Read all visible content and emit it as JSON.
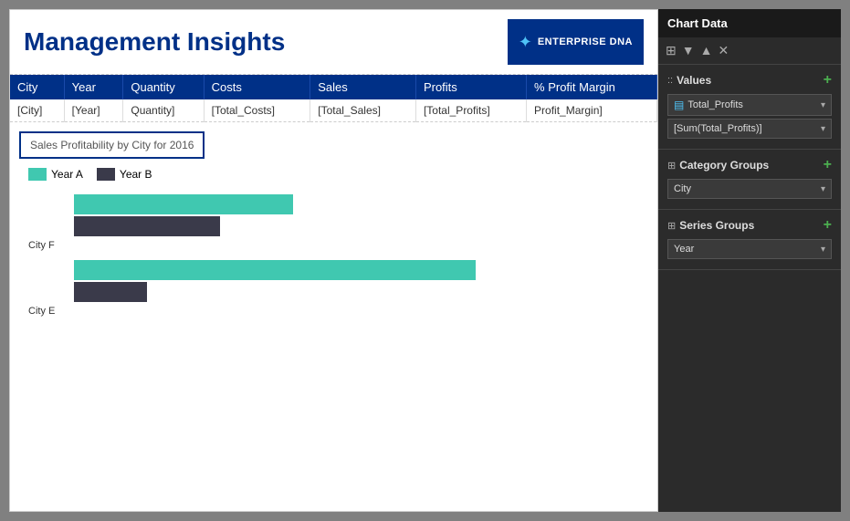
{
  "header": {
    "title": "Management Insights",
    "logo_text": "ENTERPRISE DNA"
  },
  "table": {
    "columns": [
      {
        "key": "city",
        "label": "City"
      },
      {
        "key": "year",
        "label": "Year"
      },
      {
        "key": "quantity",
        "label": "Quantity"
      },
      {
        "key": "costs",
        "label": "Costs"
      },
      {
        "key": "sales",
        "label": "Sales"
      },
      {
        "key": "profits",
        "label": "Profits"
      },
      {
        "key": "margin",
        "label": "% Profit Margin"
      }
    ],
    "row": {
      "city": "[City]",
      "year": "[Year]",
      "quantity": "Quantity]",
      "costs": "[Total_Costs]",
      "sales": "[Total_Sales]",
      "profits": "[Total_Profits]",
      "margin": "Profit_Margin]"
    }
  },
  "chart": {
    "title": "Sales Profitability by City for 2016",
    "legend": {
      "year_a_label": "Year A",
      "year_b_label": "Year B"
    },
    "cities": [
      {
        "name": "City F",
        "year_a_width": 240,
        "year_b_width": 160
      },
      {
        "name": "City E",
        "year_a_width": 440,
        "year_b_width": 80
      }
    ]
  },
  "right_panel": {
    "title": "Chart Data",
    "toolbar_icons": [
      "grid",
      "down",
      "up",
      "close"
    ],
    "values_section": {
      "label": "Values",
      "field_name": "Total_Profits",
      "field_expression": "[Sum(Total_Profits)]"
    },
    "category_section": {
      "label": "Category Groups",
      "field_name": "City"
    },
    "series_section": {
      "label": "Series Groups",
      "field_name": "Year"
    }
  }
}
